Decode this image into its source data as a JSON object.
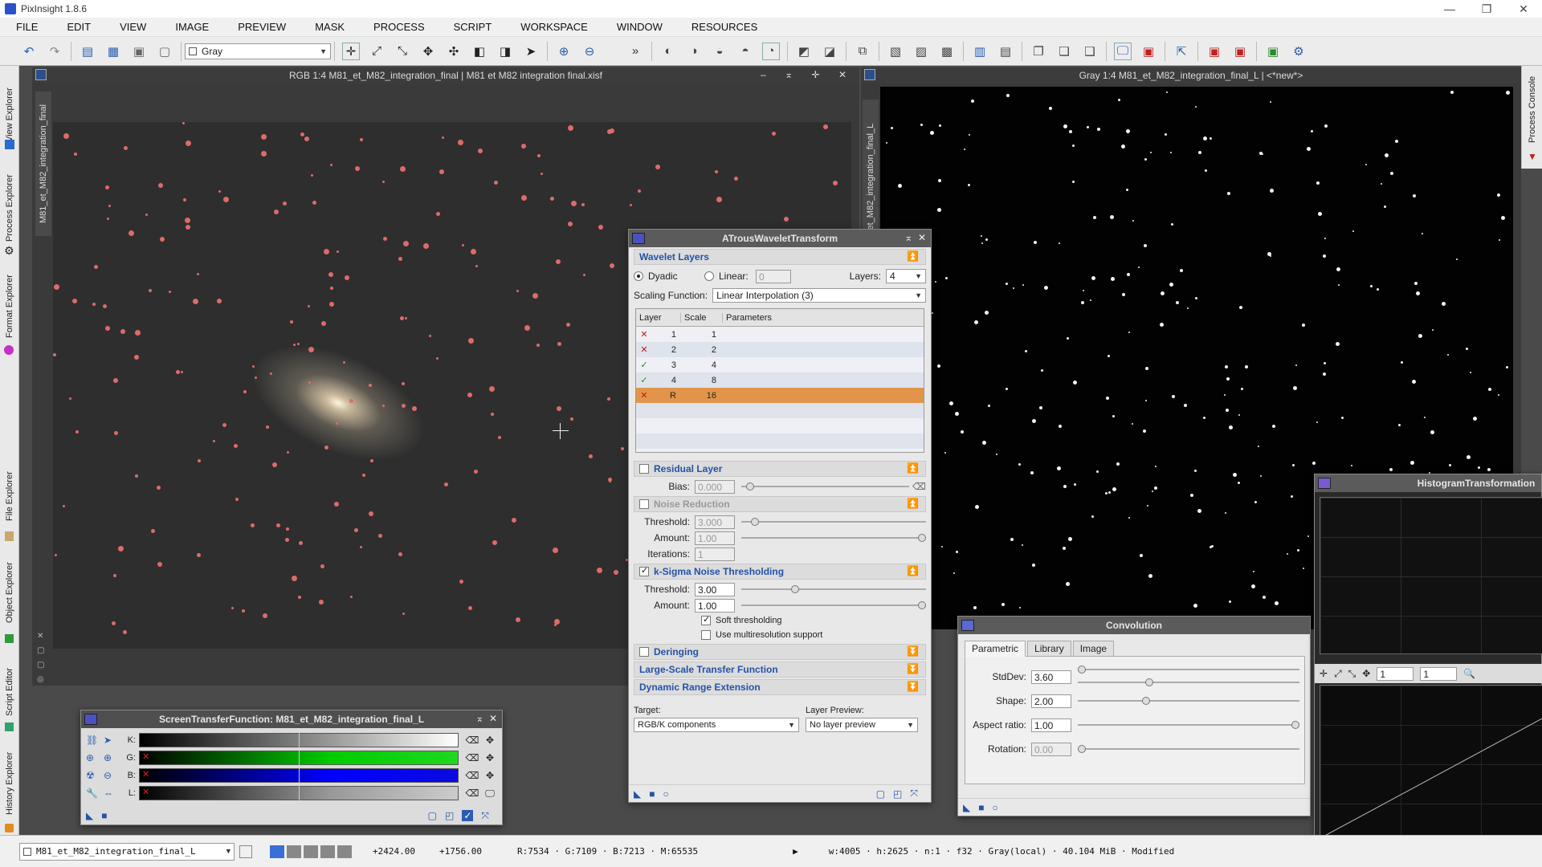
{
  "app": {
    "title": "PixInsight 1.8.6",
    "window_controls": [
      "—",
      "❐",
      "✕"
    ]
  },
  "menu": [
    "FILE",
    "EDIT",
    "VIEW",
    "IMAGE",
    "PREVIEW",
    "MASK",
    "PROCESS",
    "SCRIPT",
    "WORKSPACE",
    "WINDOW",
    "RESOURCES"
  ],
  "toolbar": {
    "channel_combo": "Gray",
    "overflow": "»"
  },
  "left_tabs": [
    "View Explorer",
    "Process Explorer",
    "Format Explorer",
    "File Explorer",
    "Object Explorer",
    "Script Editor",
    "History Explorer"
  ],
  "right_tabs": [
    "Process Console"
  ],
  "rgb_window": {
    "title": "RGB 1:4 M81_et_M82_integration_final | M81 et M82 integration final.xisf",
    "side_tab": "M81_et_M82_integration_final",
    "controls": "– ⌅ ✛ ✕"
  },
  "gray_window": {
    "title": "Gray 1:4 M81_et_M82_integration_final_L | <*new*>",
    "side_tab": "M81_et_M82_integration_final_L"
  },
  "atrous": {
    "title": "ATrousWaveletTransform",
    "wavelet_layers": "Wavelet Layers",
    "dyadic": "Dyadic",
    "linear": "Linear:",
    "linear_value": "0",
    "layers_label": "Layers:",
    "layers_value": "4",
    "scaling_label": "Scaling Function:",
    "scaling_value": "Linear Interpolation (3)",
    "table_headers": [
      "Layer",
      "Scale",
      "Parameters"
    ],
    "table_rows": [
      {
        "on": "✕",
        "layer": "1",
        "scale": "1"
      },
      {
        "on": "✕",
        "layer": "2",
        "scale": "2"
      },
      {
        "on": "✓",
        "layer": "3",
        "scale": "4"
      },
      {
        "on": "✓",
        "layer": "4",
        "scale": "8"
      },
      {
        "on": "✕",
        "layer": "R",
        "scale": "16"
      }
    ],
    "residual_layer": "Residual Layer",
    "bias_label": "Bias:",
    "bias_value": "0.000",
    "noise_reduction": "Noise Reduction",
    "nr_threshold_label": "Threshold:",
    "nr_threshold_value": "3.000",
    "nr_amount_label": "Amount:",
    "nr_amount_value": "1.00",
    "nr_iterations_label": "Iterations:",
    "nr_iterations_value": "1",
    "ksigma": "k-Sigma Noise Thresholding",
    "ks_threshold_label": "Threshold:",
    "ks_threshold_value": "3.00",
    "ks_amount_label": "Amount:",
    "ks_amount_value": "1.00",
    "soft_thresholding": "Soft thresholding",
    "multires": "Use multiresolution support",
    "deringing": "Deringing",
    "lstf": "Large-Scale Transfer Function",
    "dre": "Dynamic Range Extension",
    "target_label": "Target:",
    "target_value": "RGB/K components",
    "layer_preview_label": "Layer Preview:",
    "layer_preview_value": "No layer preview"
  },
  "convolution": {
    "title": "Convolution",
    "tabs": [
      "Parametric",
      "Library",
      "Image"
    ],
    "stddev_label": "StdDev:",
    "stddev_value": "3.60",
    "shape_label": "Shape:",
    "shape_value": "2.00",
    "aspect_label": "Aspect ratio:",
    "aspect_value": "1.00",
    "rotation_label": "Rotation:",
    "rotation_value": "0.00"
  },
  "histogram": {
    "title": "HistogramTransformation",
    "zoom1": "1",
    "zoom2": "1"
  },
  "stf": {
    "title": "ScreenTransferFunction: M81_et_M82_integration_final_L",
    "channels": [
      "K:",
      "G:",
      "B:",
      "L:"
    ]
  },
  "status": {
    "view": "M81_et_M82_integration_final_L",
    "x": "+2424.00",
    "y": "+1756.00",
    "pixel": "R:7534 · G:7109 · B:7213 · M:65535",
    "info": "w:4005 · h:2625 · n:1 · f32 · Gray(local) · 40.104 MiB · Modified"
  }
}
